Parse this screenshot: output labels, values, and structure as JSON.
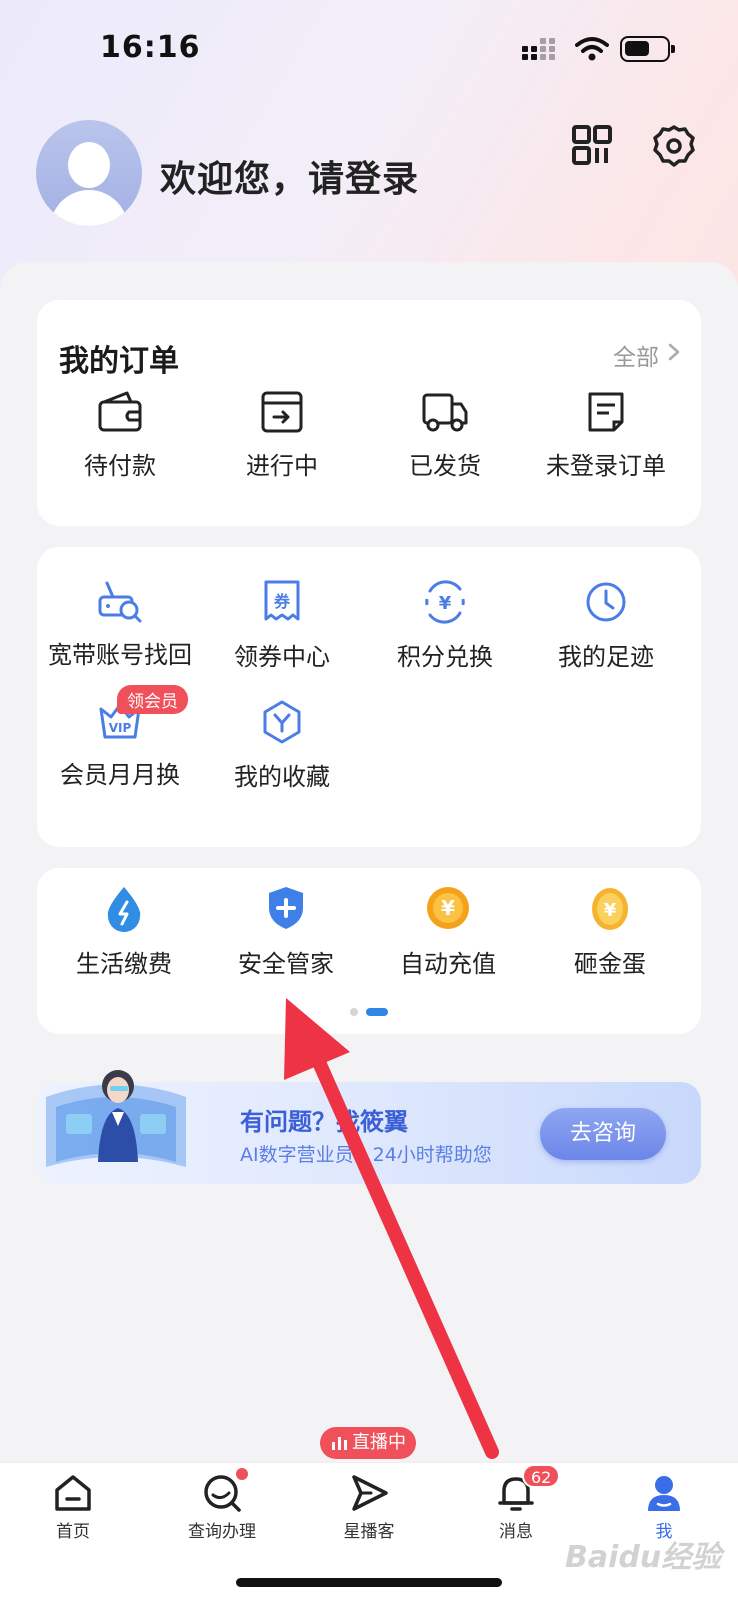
{
  "status_bar": {
    "time": "16:16"
  },
  "header": {
    "welcome_text": "欢迎您，请登录"
  },
  "orders": {
    "title": "我的订单",
    "all_label": "全部",
    "items": [
      {
        "label": "待付款",
        "icon": "wallet-icon"
      },
      {
        "label": "进行中",
        "icon": "archive-box-icon"
      },
      {
        "label": "已发货",
        "icon": "truck-icon"
      },
      {
        "label": "未登录订单",
        "icon": "document-icon"
      }
    ]
  },
  "services": {
    "items": [
      {
        "label": "宽带账号找回",
        "icon": "broadband-search-icon"
      },
      {
        "label": "领券中心",
        "icon": "coupon-icon"
      },
      {
        "label": "积分兑换",
        "icon": "points-exchange-icon"
      },
      {
        "label": "我的足迹",
        "icon": "clock-icon"
      },
      {
        "label": "会员月月换",
        "icon": "vip-icon",
        "badge": "领会员"
      },
      {
        "label": "我的收藏",
        "icon": "favorite-icon"
      }
    ]
  },
  "payments": {
    "items": [
      {
        "label": "生活缴费",
        "icon": "water-drop-icon"
      },
      {
        "label": "安全管家",
        "icon": "shield-icon"
      },
      {
        "label": "自动充值",
        "icon": "yuan-coin-icon"
      },
      {
        "label": "砸金蛋",
        "icon": "golden-egg-icon"
      }
    ],
    "page_indicator": {
      "total": 2,
      "active": 2
    }
  },
  "banner": {
    "title": "有问题？找筱翼",
    "subtitle": "AI数字营业员，24小时帮助您",
    "button_label": "去咨询"
  },
  "tabbar": {
    "items": [
      {
        "label": "首页",
        "icon": "home-icon"
      },
      {
        "label": "查询办理",
        "icon": "search-query-icon"
      },
      {
        "label": "星播客",
        "icon": "send-icon"
      },
      {
        "label": "消息",
        "icon": "bell-icon"
      },
      {
        "label": "我",
        "icon": "person-icon",
        "active": true
      }
    ],
    "live_badge": "直播中",
    "message_count": "62"
  },
  "watermark": "Baidu经验",
  "colors": {
    "accent": "#3a6ee8",
    "badge_red": "#f0505a",
    "icon_blue": "#4a7ee6"
  }
}
